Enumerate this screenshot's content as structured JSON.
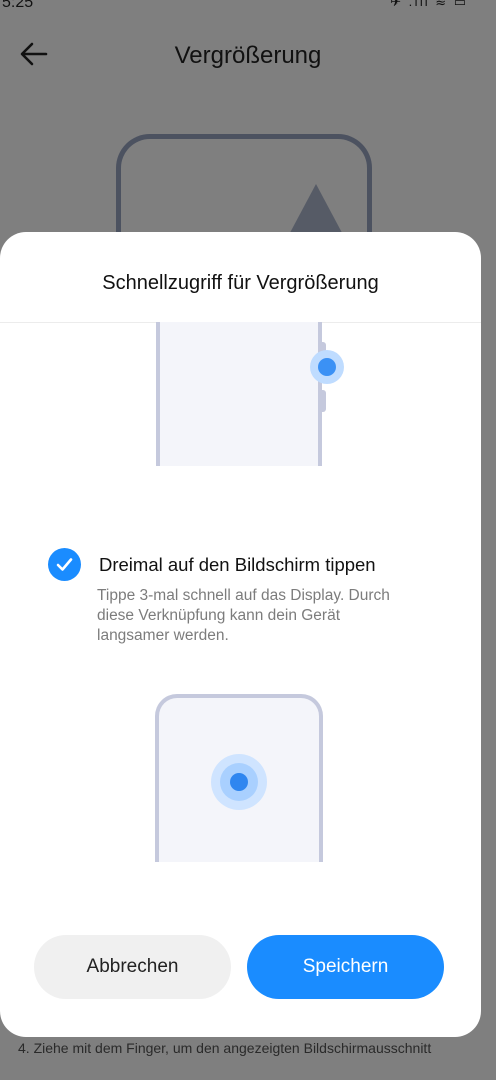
{
  "status_bar": {
    "time": "5:25",
    "icons_text": "✈ .ıll ≋ ▭"
  },
  "background_page": {
    "title": "Vergrößerung",
    "footer_text": "4. Ziehe mit dem Finger, um den angezeigten Bildschirmausschnitt"
  },
  "dialog": {
    "title": "Schnellzugriff für Vergrößerung",
    "option": {
      "checked": true,
      "label": "Dreimal auf den Bildschirm tippen",
      "description": "Tippe 3-mal schnell auf das Display. Durch diese Verknüpfung kann dein Gerät langsamer werden."
    },
    "cancel_label": "Abbrechen",
    "save_label": "Speichern"
  },
  "colors": {
    "accent": "#1a8cff",
    "scrim": "#7f7f7f",
    "illustration_outline": "#c5c9dd"
  }
}
